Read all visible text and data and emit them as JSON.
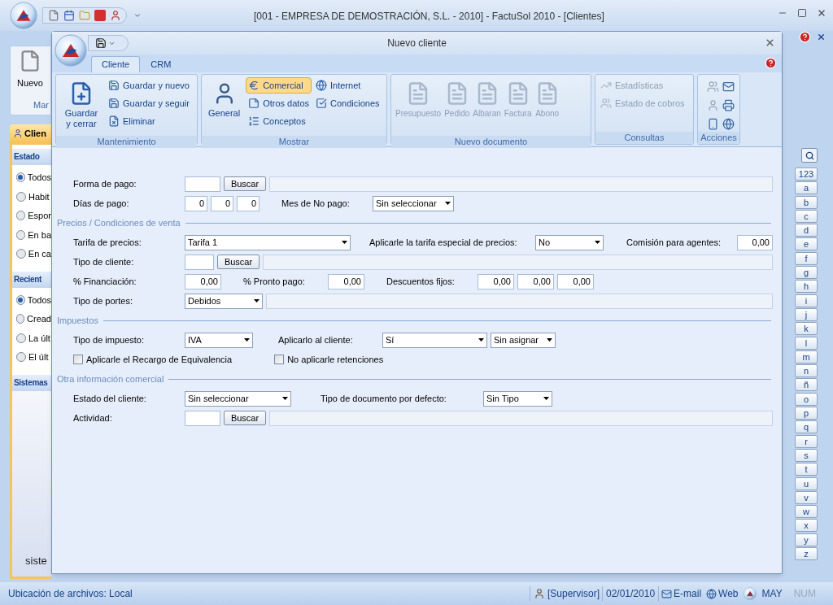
{
  "app": {
    "title": "[001 - EMPRESA DE DEMOSTRACIÓN, S.L. - 2010] - FactuSol 2010 - [Clientes]",
    "ribbon_button": "Nuevo",
    "ribbon_group": "Mar",
    "tab": "Clien"
  },
  "side_panel": {
    "sections": [
      {
        "title": "Estado",
        "options": [
          {
            "label": "Todos",
            "selected": true
          },
          {
            "label": "Habit",
            "selected": false
          },
          {
            "label": "Espor",
            "selected": false
          },
          {
            "label": "En ba",
            "selected": false
          },
          {
            "label": "En ca",
            "selected": false
          }
        ]
      },
      {
        "title": "Recient",
        "options": [
          {
            "label": "Todos",
            "selected": true
          },
          {
            "label": "Cread",
            "selected": false
          },
          {
            "label": "La últ",
            "selected": false
          },
          {
            "label": "El últ",
            "selected": false
          }
        ]
      },
      {
        "title": "Sistemas"
      }
    ],
    "footer_text": "siste"
  },
  "index_bar": {
    "keys": [
      "123",
      "a",
      "b",
      "c",
      "d",
      "e",
      "f",
      "g",
      "h",
      "i",
      "j",
      "k",
      "l",
      "m",
      "n",
      "ñ",
      "o",
      "p",
      "q",
      "r",
      "s",
      "t",
      "u",
      "v",
      "w",
      "x",
      "y",
      "z"
    ]
  },
  "status_bar": {
    "location": "Ubicación de archivos: Local",
    "user": "[Supervisor]",
    "date": "02/01/2010",
    "links": [
      "E-mail",
      "Web"
    ],
    "indicators": [
      {
        "label": "MAY",
        "on": true
      },
      {
        "label": "NUM",
        "on": false
      }
    ]
  },
  "dialog": {
    "title": "Nuevo cliente",
    "tabs": [
      {
        "label": "Cliente",
        "selected": true
      },
      {
        "label": "CRM",
        "selected": false
      }
    ],
    "groups": [
      {
        "title": "Mantenimiento",
        "kind": "buttons",
        "columns": [
          [
            {
              "label": "Guardar y cerrar",
              "kind": "large",
              "disabled": false
            }
          ],
          [
            {
              "label": "Guardar y nuevo",
              "kind": "small",
              "disabled": false
            },
            {
              "label": "Guardar y seguir",
              "kind": "small",
              "disabled": false
            },
            {
              "label": "Eliminar",
              "kind": "small",
              "disabled": false
            }
          ]
        ]
      },
      {
        "title": "Mostrar",
        "kind": "buttons",
        "columns": [
          [
            {
              "label": "General",
              "kind": "large",
              "disabled": false,
              "selected": false
            }
          ],
          [
            {
              "label": "Comercial",
              "kind": "small",
              "disabled": false,
              "selected": true
            },
            {
              "label": "Otros datos",
              "kind": "small",
              "disabled": false,
              "selected": false
            },
            {
              "label": "Conceptos",
              "kind": "small",
              "disabled": false,
              "selected": false
            }
          ],
          [
            {
              "label": "Internet",
              "kind": "small",
              "disabled": false,
              "selected": false
            },
            {
              "label": "Condiciones",
              "kind": "small",
              "disabled": false,
              "selected": false
            }
          ]
        ]
      },
      {
        "title": "Nuevo documento",
        "kind": "buttons",
        "columns": [
          [
            {
              "label": "Presupuesto",
              "kind": "large",
              "disabled": true
            }
          ],
          [
            {
              "label": "Pedido",
              "kind": "large",
              "disabled": true
            }
          ],
          [
            {
              "label": "Albaran",
              "kind": "large",
              "disabled": true
            }
          ],
          [
            {
              "label": "Factura",
              "kind": "large",
              "disabled": true
            }
          ],
          [
            {
              "label": "Abono",
              "kind": "large",
              "disabled": true
            }
          ]
        ]
      },
      {
        "title": "Consultas",
        "kind": "buttons",
        "columns": [
          [
            {
              "label": "Estadísticas",
              "kind": "small",
              "disabled": true
            },
            {
              "label": "Estado de cobros",
              "kind": "small",
              "disabled": true
            }
          ]
        ]
      },
      {
        "title": "Acciones",
        "kind": "icons"
      }
    ],
    "form": {
      "forma_pago": {
        "label": "Forma de pago:",
        "button": "Buscar"
      },
      "dias_pago": {
        "label": "Días de pago:",
        "values": [
          "0",
          "0",
          "0"
        ]
      },
      "mes_no_pago": {
        "label": "Mes de No pago:",
        "value": "Sin seleccionar"
      },
      "precios_title": "Precios / Condiciones de venta",
      "tarifa": {
        "label": "Tarifa de precios:",
        "value": "Tarifa 1"
      },
      "tarifa_especial": {
        "label": "Aplicarle la tarifa especial de precios:",
        "value": "No"
      },
      "comision": {
        "label": "Comisión para agentes:",
        "value": "0,00"
      },
      "tipo_cliente": {
        "label": "Tipo de cliente:",
        "button": "Buscar"
      },
      "financiacion": {
        "label": "% Financiación:",
        "value": "0,00"
      },
      "pronto_pago": {
        "label": "% Pronto pago:",
        "value": "0,00"
      },
      "descuentos": {
        "label": "Descuentos fijos:",
        "values": [
          "0,00",
          "0,00",
          "0,00"
        ]
      },
      "portes": {
        "label": "Tipo de portes:",
        "value": "Debidos"
      },
      "impuestos_title": "Impuestos",
      "tipo_impuesto": {
        "label": "Tipo de impuesto:",
        "value": "IVA"
      },
      "aplicarlo": {
        "label": "Aplicarlo al cliente:",
        "value": "Sí",
        "second_value": "Sin asignar"
      },
      "recargo": {
        "label": "Aplicarle el Recargo de Equivalencia",
        "checked": false
      },
      "retenciones": {
        "label": "No aplicarle retenciones",
        "checked": false
      },
      "otra_title": "Otra información comercial",
      "estado": {
        "label": "Estado del cliente:",
        "value": "Sin seleccionar"
      },
      "tipo_documento": {
        "label": "Tipo de documento por defecto:",
        "value": "Sin Tipo"
      },
      "actividad": {
        "label": "Actividad:",
        "button": "Buscar"
      }
    }
  }
}
